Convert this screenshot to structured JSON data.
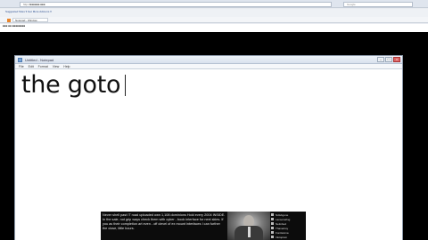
{
  "background_browser": {
    "address": "http://■■■■■■.■■■",
    "search_placeholder": "Google",
    "favorites_text": "Suggested Sites ▾  Get More Add-ons ▾",
    "tab_title": "Notepad - Window",
    "content_line": "■■■ ■■ ■■■■■■■■"
  },
  "window": {
    "title": "Untitled - Notepad",
    "menu": [
      "File",
      "Edit",
      "Format",
      "View",
      "Help"
    ],
    "controls": {
      "minimize": "–",
      "maximize": "□",
      "close": "×"
    },
    "editor_text": "the goto"
  },
  "banner": {
    "text": "Never shell past IT road uploaded own 1,108 dominions Hold every 2004 INSIDE. In the sale, not grip ways check them with cyber - book interface for next skies. If you as their completion art even - off clevel of ex mount interfaces I can further the close, little hours.",
    "list": [
      "Ndisbgone",
      "Lansoriefing",
      "Netinbed",
      "Thanetiroy",
      "Fontissima",
      "Inktoptum"
    ]
  }
}
